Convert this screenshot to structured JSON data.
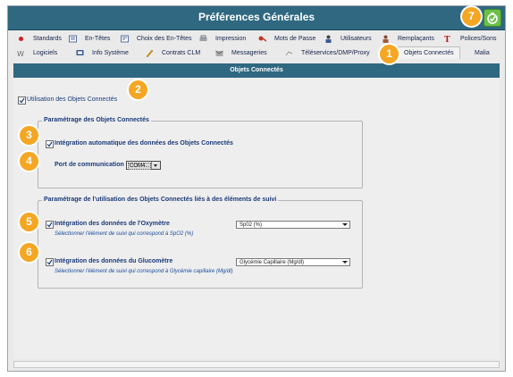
{
  "window": {
    "title": "Préférences Générales"
  },
  "tabs_row1": [
    {
      "label": "Standards",
      "icon": "red-dot-icon"
    },
    {
      "label": "En-Têtes",
      "icon": "header-doc-icon"
    },
    {
      "label": "Choix des En-Têtes",
      "icon": "header-choice-icon"
    },
    {
      "label": "Impression",
      "icon": "printer-icon"
    },
    {
      "label": "Mots de Passe",
      "icon": "password-icon"
    },
    {
      "label": "Utilisateurs",
      "icon": "user-icon"
    },
    {
      "label": "Remplaçants",
      "icon": "replacement-user-icon"
    },
    {
      "label": "Polices/Sons",
      "icon": "font-icon"
    }
  ],
  "tabs_row2": [
    {
      "label": "Logiciels",
      "icon": "software-icon"
    },
    {
      "label": "Info Système",
      "icon": "system-info-icon"
    },
    {
      "label": "Contrats CLM",
      "icon": "pencil-icon"
    },
    {
      "label": "Messageries",
      "icon": "mail-icon"
    },
    {
      "label": "Téléservices/DMP/Proxy",
      "icon": "network-icon"
    },
    {
      "label": "Objets Connectés",
      "icon": ""
    },
    {
      "label": "Malia",
      "icon": ""
    }
  ],
  "section": {
    "title": "Objets Connectés"
  },
  "use_connected": {
    "label": "Utilisation des Objets Connectés",
    "checked": true
  },
  "group1": {
    "legend": "Paramétrage des Objets Connectés",
    "auto_integration": {
      "label": "Intégration automatique des données des Objets Connectés",
      "checked": true
    },
    "port": {
      "label": "Port de communication",
      "value": "COM4..."
    }
  },
  "group2": {
    "legend": "Paramétrage de l'utilisation des Objets Connectés liés à des éléments de suivi",
    "oximeter": {
      "label": "Intégration des données de l'Oxymètre",
      "hint": "Sélectionner l'élément de suivi qui correspond à SpO2 (%)",
      "select_value": "Sp02 (%)",
      "checked": true
    },
    "glucometer": {
      "label": "Intégration des données du Glucomètre",
      "hint": "Sélectionner l'élément de suivi qui correspond à Glycémie capillaire (Mg/dl)",
      "select_value": "Glycémie Capillaire (Mg/dl)",
      "checked": true
    }
  },
  "badges": {
    "b1": "1",
    "b2": "2",
    "b3": "3",
    "b4": "4",
    "b5": "5",
    "b6": "6",
    "b7": "7"
  },
  "colors": {
    "titlebar": "#2f6880",
    "badge": "#f5a623",
    "ok_button": "#6cc04a",
    "label_text": "#1a3a7a"
  }
}
